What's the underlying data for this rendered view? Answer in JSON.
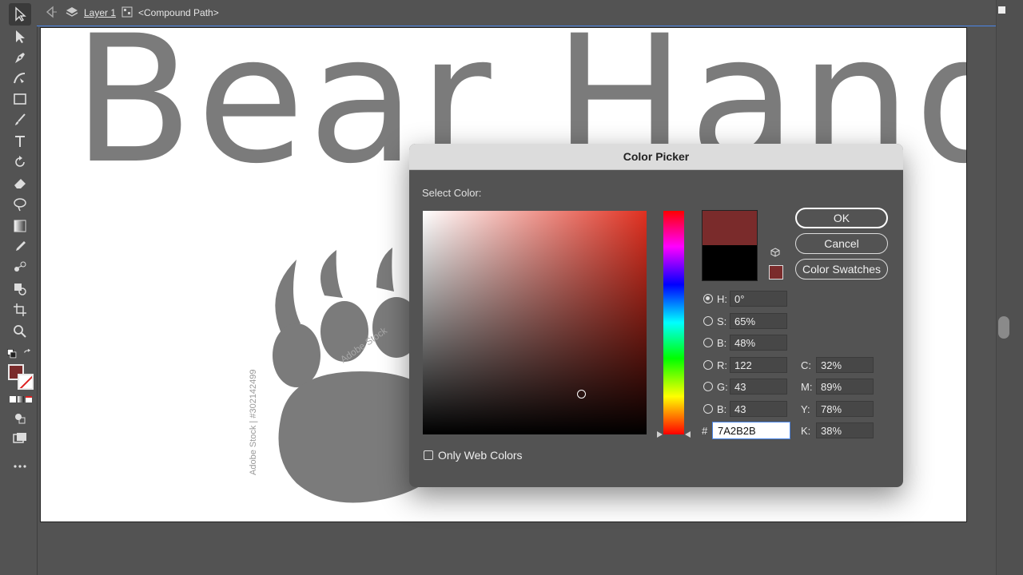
{
  "breadcrumb": {
    "layer": "Layer 1",
    "path": "<Compound Path>"
  },
  "artboard": {
    "title": "Bear Hands",
    "watermark": "Adobe Stock | #302142499",
    "wm_overlay": "Adobe Stock"
  },
  "colors": {
    "current_fill": "#7A2B2B",
    "accent": "#4a86e8"
  },
  "tools": [
    "selection-tool-icon",
    "direct-selection-tool-icon",
    "pen-tool-icon",
    "curvature-tool-icon",
    "rectangle-tool-icon",
    "paintbrush-tool-icon",
    "type-tool-icon",
    "rotate-tool-icon",
    "eraser-tool-icon",
    "lasso-tool-icon",
    "gradient-tool-icon",
    "eyedropper-tool-icon",
    "blend-tool-icon",
    "shape-builder-icon",
    "artboard-tool-icon",
    "zoom-tool-icon"
  ],
  "dialog": {
    "title": "Color Picker",
    "select_color": "Select Color:",
    "ok": "OK",
    "cancel": "Cancel",
    "color_swatches": "Color Swatches",
    "only_web_colors": "Only Web Colors",
    "fields": {
      "H": {
        "label": "H:",
        "value": "0°",
        "selected": true
      },
      "S": {
        "label": "S:",
        "value": "65%"
      },
      "Bv": {
        "label": "B:",
        "value": "48%"
      },
      "R": {
        "label": "R:",
        "value": "122"
      },
      "G": {
        "label": "G:",
        "value": "43"
      },
      "Blue": {
        "label": "B:",
        "value": "43"
      },
      "hex_label": "#",
      "hex": "7A2B2B",
      "C": {
        "label": "C:",
        "value": "32%"
      },
      "M": {
        "label": "M:",
        "value": "89%"
      },
      "Y": {
        "label": "Y:",
        "value": "78%"
      },
      "K": {
        "label": "K:",
        "value": "38%"
      }
    }
  }
}
